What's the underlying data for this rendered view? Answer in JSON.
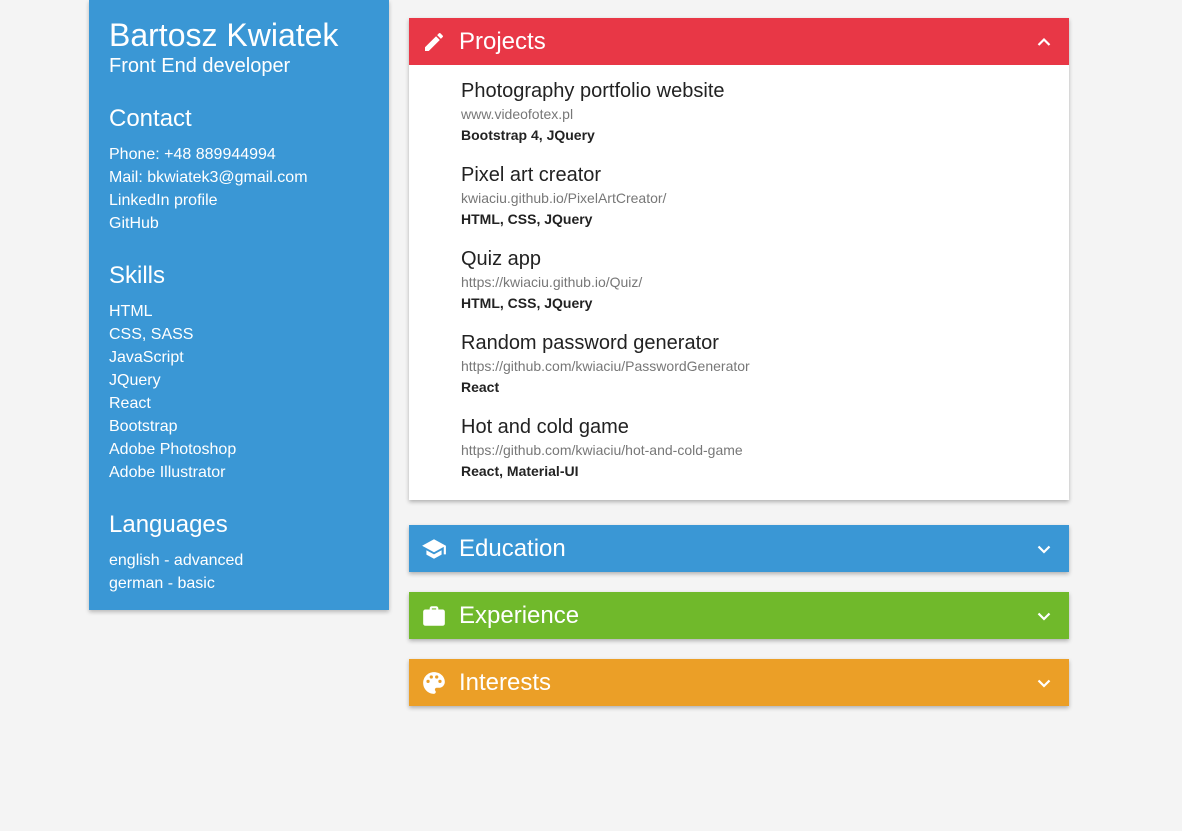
{
  "profile": {
    "name": "Bartosz Kwiatek",
    "role": "Front End developer"
  },
  "contact": {
    "title": "Contact",
    "items": [
      "Phone: +48 889944994",
      "Mail: bkwiatek3@gmail.com",
      "LinkedIn profile",
      "GitHub"
    ]
  },
  "skills": {
    "title": "Skills",
    "items": [
      "HTML",
      "CSS, SASS",
      "JavaScript",
      "JQuery",
      "React",
      "Bootstrap",
      "Adobe Photoshop",
      "Adobe Illustrator"
    ]
  },
  "languages": {
    "title": "Languages",
    "items": [
      "english - advanced",
      "german - basic"
    ]
  },
  "panels": {
    "projects": {
      "title": "Projects",
      "icon": "pencil-icon",
      "color": "#e83746",
      "expanded": true,
      "items": [
        {
          "name": "Photography portfolio website",
          "url": "www.videofotex.pl",
          "tech": "Bootstrap 4, JQuery"
        },
        {
          "name": "Pixel art creator",
          "url": "kwiaciu.github.io/PixelArtCreator/",
          "tech": "HTML, CSS, JQuery"
        },
        {
          "name": "Quiz app",
          "url": "https://kwiaciu.github.io/Quiz/",
          "tech": "HTML, CSS, JQuery"
        },
        {
          "name": "Random password generator",
          "url": "https://github.com/kwiaciu/PasswordGenerator",
          "tech": "React"
        },
        {
          "name": "Hot and cold game",
          "url": "https://github.com/kwiaciu/hot-and-cold-game",
          "tech": "React, Material-UI"
        }
      ]
    },
    "education": {
      "title": "Education",
      "icon": "graduation-cap-icon",
      "color": "#3a97d5",
      "expanded": false
    },
    "experience": {
      "title": "Experience",
      "icon": "briefcase-icon",
      "color": "#70b92b",
      "expanded": false
    },
    "interests": {
      "title": "Interests",
      "icon": "palette-icon",
      "color": "#eb9f27",
      "expanded": false
    }
  },
  "colors": {
    "background": "#f4f4f4",
    "sidebar": "#3a97d5"
  }
}
